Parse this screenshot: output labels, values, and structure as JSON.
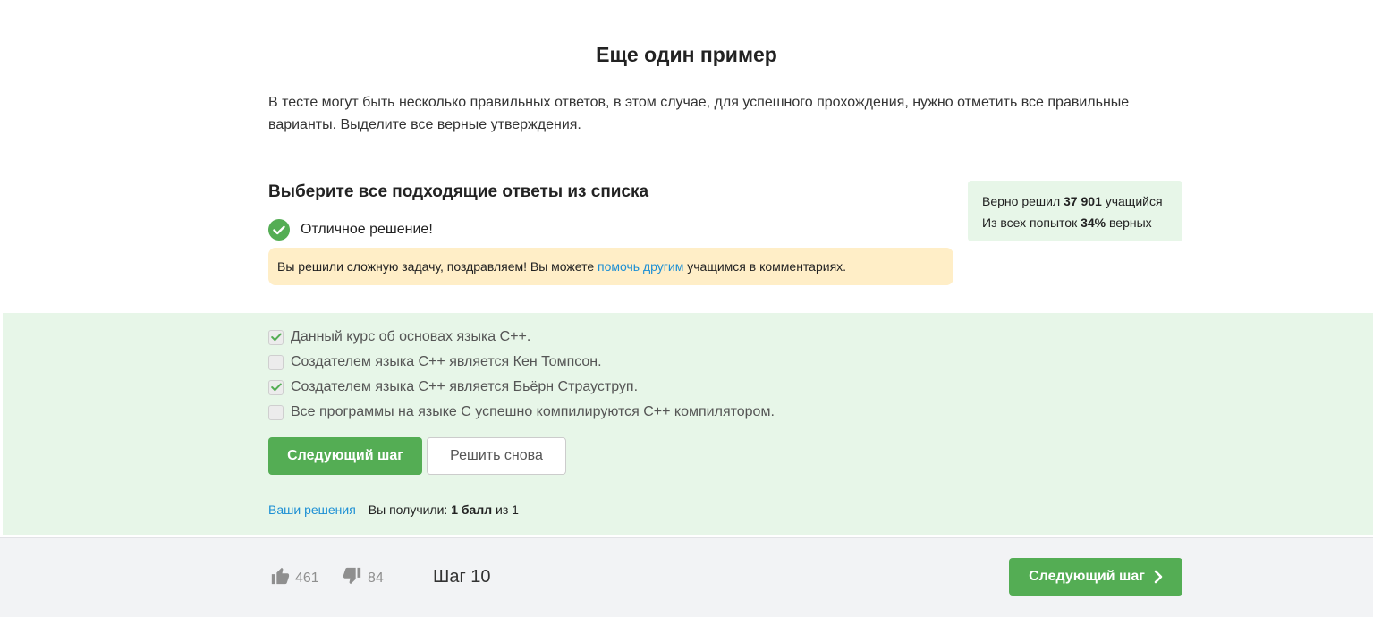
{
  "page": {
    "title": "Еще один пример",
    "intro": "В тесте могут быть несколько правильных ответов, в этом случае, для успешного прохождения, нужно отметить все правильные варианты. Выделите все верные утверждения."
  },
  "question": {
    "title": "Выберите все подходящие ответы из списка",
    "result_text": "Отличное решение!"
  },
  "notice": {
    "before": "Вы решили сложную задачу, поздравляем! Вы можете ",
    "link": "помочь другим",
    "after": " учащимся в комментариях."
  },
  "stats": {
    "line1_prefix": "Верно решил ",
    "solved_count": "37 901",
    "line1_suffix": " учащийся",
    "line2_prefix": "Из всех попыток ",
    "percent": "34%",
    "line2_suffix": " верных"
  },
  "options": [
    {
      "label": "Данный курс об основах языка C++.",
      "checked": true
    },
    {
      "label": "Создателем языка C++ является Кен Томпсон.",
      "checked": false
    },
    {
      "label": "Создателем языка C++ является Бьёрн Страуструп.",
      "checked": true
    },
    {
      "label": "Все программы на языке C успешно компилируются C++ компилятором.",
      "checked": false
    }
  ],
  "buttons": {
    "next": "Следующий шаг",
    "retry": "Решить снова"
  },
  "footer": {
    "solutions_link": "Ваши решения",
    "score_prefix": "Вы получили: ",
    "score_value": "1 балл",
    "score_suffix": " из 1"
  },
  "bottom_bar": {
    "likes": "461",
    "dislikes": "84",
    "step": "Шаг 10",
    "next": "Следующий шаг"
  },
  "colors": {
    "accent_green": "#54ad54",
    "panel_green": "#e7f6e8",
    "notice_yellow": "#ffeec7",
    "link_blue": "#1c8fd4"
  },
  "icons": [
    "check-circle-icon",
    "checkmark-icon",
    "thumbs-up-icon",
    "thumbs-down-icon",
    "chevron-right-icon"
  ]
}
